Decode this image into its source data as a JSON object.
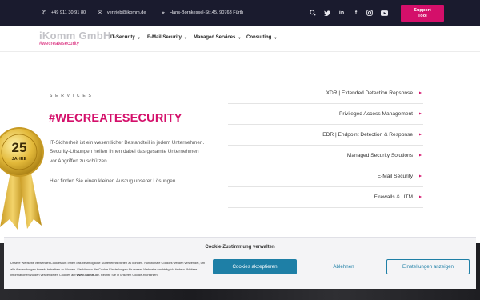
{
  "topbar": {
    "phone": "+49 911 30 91 80",
    "email": "vertrieb@ikomm.de",
    "address": "Hans-Bornkessel-Str.45, 90763 Fürth",
    "support_line1": "Support",
    "support_line2": "Tool",
    "social_icons": [
      "search-icon",
      "twitter-icon",
      "linkedin-icon",
      "facebook-icon",
      "instagram-icon",
      "youtube-icon"
    ]
  },
  "nav": {
    "logo": "iKomm GmbH",
    "tagline": "#wecreatesecurity",
    "items": [
      {
        "label": "IT-Security"
      },
      {
        "label": "E-Mail Security"
      },
      {
        "label": "Managed Services"
      },
      {
        "label": "Consulting"
      }
    ]
  },
  "hero": {
    "eyebrow": "SERVICES",
    "headline": "#WECREATESECURITY",
    "paragraph": "IT-Sicherheit ist ein wesentlicher Bestandteil in jedem Unternehmen. Security-Lösungen helfen Ihnen dabei das gesamte Unternehmen vor Angriffen zu schützen.",
    "paragraph2": "Hier finden Sie einen kleinen Auszug unserer Lösungen",
    "badge_number": "25",
    "badge_text": "JAHRE"
  },
  "services": [
    {
      "label": "XDR | Extended Detection Repsonse"
    },
    {
      "label": "Privileged Access Management"
    },
    {
      "label": "EDR | Endpoint Detection & Response"
    },
    {
      "label": "Managed Security Solutions"
    },
    {
      "label": "E-Mail Security"
    },
    {
      "label": "Firewalls & UTM"
    }
  ],
  "cookie": {
    "title": "Cookie-Zustimmung verwalten",
    "text_part1": "Unsere Webseite verwendet Cookies um Ihnen das bestmögliche Surferlebnis bieten zu können. Funktionale Cookies werden verwendet, um alle Anwendungen korrekt betreiben zu können. Sie können die Cookie Einstellungen für unsere Webseite nachträglich ändern. Weitere Informationen zu den verwendeten Cookies auf ",
    "text_link": "www.ikomm.de",
    "text_part2": ". Rechte Sie in unseren Cookie-Richtlinien",
    "accept": "Cookies akzeptieren",
    "deny": "Ablehnen",
    "settings": "Einstellungen anzeigen"
  },
  "colors": {
    "brand": "#d40f6a",
    "topbar": "#1a1b2e",
    "cookie_accent": "#1e7fa6"
  }
}
